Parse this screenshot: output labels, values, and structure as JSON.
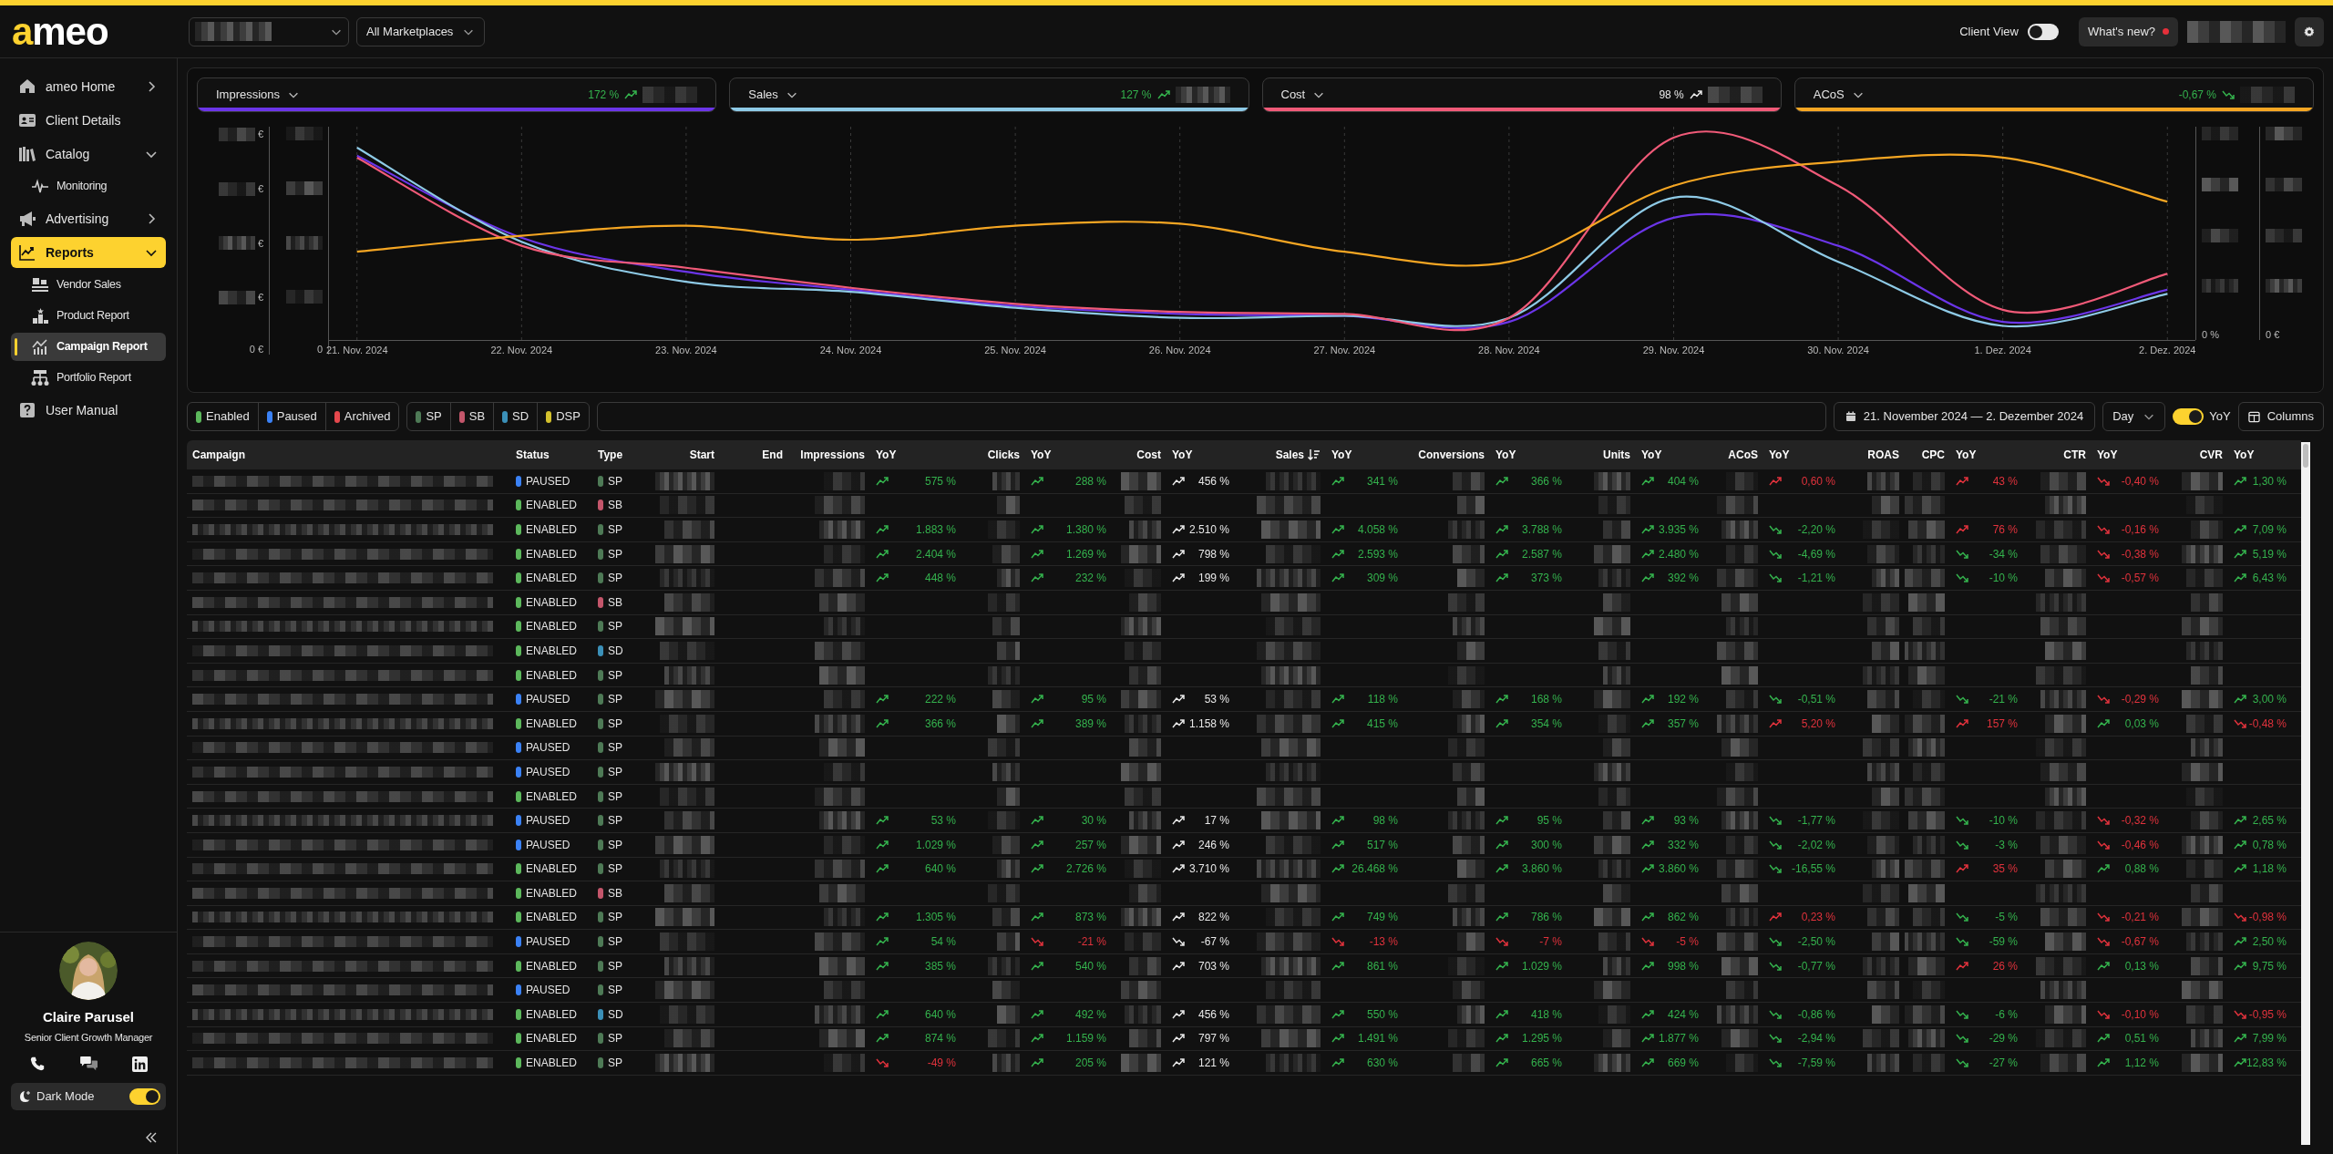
{
  "top_bar": {
    "logo": {
      "accent": "a",
      "rest": "meo"
    },
    "marketplace": "All Marketplaces",
    "client_view": {
      "label": "Client View",
      "on": false
    },
    "whats_new": {
      "label": "What's new?",
      "unread": true
    }
  },
  "sidebar": {
    "items": [
      {
        "label": "ameo Home",
        "expanded": false,
        "selected": false
      },
      {
        "label": "Client Details",
        "selected": false
      },
      {
        "label": "Catalog",
        "expanded": true,
        "selected": false,
        "children": [
          {
            "label": "Monitoring",
            "selected": false
          }
        ]
      },
      {
        "label": "Advertising",
        "expanded": false,
        "selected": false
      },
      {
        "label": "Reports",
        "expanded": true,
        "selected": true,
        "children": [
          {
            "label": "Vendor Sales",
            "selected": false
          },
          {
            "label": "Product Report",
            "selected": false
          },
          {
            "label": "Campaign Report",
            "selected": true
          },
          {
            "label": "Portfolio Report",
            "selected": false
          }
        ]
      },
      {
        "label": "User Manual",
        "selected": false
      }
    ],
    "profile": {
      "name": "Claire Parusel",
      "role": "Senior Client Growth Manager"
    },
    "dark_mode": {
      "label": "Dark Mode",
      "on": true
    }
  },
  "metrics": [
    {
      "label": "Impressions",
      "change": {
        "text": "172 %",
        "rising": true,
        "color": "#34b24d"
      },
      "color": "#6b35e8"
    },
    {
      "label": "Sales",
      "change": {
        "text": "127 %",
        "rising": true,
        "color": "#34b24d"
      },
      "color": "#8ecae6"
    },
    {
      "label": "Cost",
      "change": {
        "text": "98 %",
        "rising": true,
        "color": "#e8e8e8"
      },
      "color": "#f05a78"
    },
    {
      "label": "ACoS",
      "change": {
        "text": "-0,67 %",
        "rising": false,
        "color": "#34b24d"
      },
      "color": "#f5a623"
    }
  ],
  "chart": {
    "left_axis": {
      "tick_units": [
        "€",
        "€",
        "€",
        "€"
      ],
      "zero": "0 €"
    },
    "left_axis_2": {
      "zero": "0"
    },
    "right_axis": {
      "zero": "0 %"
    },
    "right_axis_2": {
      "zero": "0 €"
    },
    "x_labels": [
      "21. Nov. 2024",
      "22. Nov. 2024",
      "23. Nov. 2024",
      "24. Nov. 2024",
      "25. Nov. 2024",
      "26. Nov. 2024",
      "27. Nov. 2024",
      "28. Nov. 2024",
      "29. Nov. 2024",
      "30. Nov. 2024",
      "1. Dez. 2024",
      "2. Dez. 2024"
    ]
  },
  "filters": {
    "status": [
      {
        "label": "Enabled",
        "color": "#5cb85c"
      },
      {
        "label": "Paused",
        "color": "#3b82f6"
      },
      {
        "label": "Archived",
        "color": "#e5484d"
      }
    ],
    "types": [
      {
        "label": "SP",
        "color": "#4e7a56"
      },
      {
        "label": "SB",
        "color": "#c4566b"
      },
      {
        "label": "SD",
        "color": "#3b90b8"
      },
      {
        "label": "DSP",
        "color": "#d3c12d"
      }
    ],
    "date_range": "21. November 2024 — 2. Dezember 2024",
    "interval": "Day",
    "yoy": {
      "label": "YoY",
      "on": true
    },
    "columns_button": "Columns"
  },
  "table": {
    "columns": [
      {
        "label": "Campaign",
        "kind": "masked",
        "sorted": false
      },
      {
        "label": "Status",
        "kind": "status",
        "sorted": false
      },
      {
        "label": "Type",
        "kind": "type",
        "sorted": false
      },
      {
        "label": "Start",
        "kind": "masked",
        "sorted": false
      },
      {
        "label": "End",
        "kind": "empty",
        "sorted": false
      },
      {
        "label": "Impressions",
        "kind": "masked",
        "sorted": false
      },
      {
        "label": "YoY",
        "kind": "yoy",
        "sorted": false
      },
      {
        "label": "Clicks",
        "kind": "masked",
        "sorted": false
      },
      {
        "label": "YoY",
        "kind": "yoy",
        "sorted": false
      },
      {
        "label": "Cost",
        "kind": "masked",
        "sorted": false
      },
      {
        "label": "YoY",
        "kind": "yoy",
        "sorted": false
      },
      {
        "label": "Sales",
        "kind": "masked",
        "sorted": true
      },
      {
        "label": "YoY",
        "kind": "yoy",
        "sorted": false
      },
      {
        "label": "Conversions",
        "kind": "masked",
        "sorted": false
      },
      {
        "label": "YoY",
        "kind": "yoy",
        "sorted": false
      },
      {
        "label": "Units",
        "kind": "masked",
        "sorted": false
      },
      {
        "label": "YoY",
        "kind": "yoy",
        "sorted": false
      },
      {
        "label": "ACoS",
        "kind": "masked",
        "sorted": false
      },
      {
        "label": "YoY",
        "kind": "yoy",
        "sorted": false
      },
      {
        "label": "ROAS",
        "kind": "masked",
        "sorted": false
      },
      {
        "label": "CPC",
        "kind": "masked",
        "sorted": false
      },
      {
        "label": "YoY",
        "kind": "yoy",
        "sorted": false
      },
      {
        "label": "CTR",
        "kind": "masked",
        "sorted": false
      },
      {
        "label": "YoY",
        "kind": "yoy",
        "sorted": false
      },
      {
        "label": "CVR",
        "kind": "masked",
        "sorted": false
      },
      {
        "label": "YoY",
        "kind": "yoy",
        "sorted": false
      }
    ],
    "rows": [
      {
        "status": {
          "label": "PAUSED",
          "color": "#3b82f6"
        },
        "type": {
          "label": "SP",
          "color": "#4e7a56"
        },
        "yoy": [
          {
            "text": "575 %",
            "rising": true,
            "color": "#34b24d"
          },
          {
            "text": "288 %",
            "rising": true,
            "color": "#34b24d"
          },
          {
            "text": "456 %",
            "rising": true,
            "color": "#e8e8e8"
          },
          {
            "text": "341 %",
            "rising": true,
            "color": "#34b24d"
          },
          {
            "text": "366 %",
            "rising": true,
            "color": "#34b24d"
          },
          {
            "text": "404 %",
            "rising": true,
            "color": "#34b24d"
          },
          {
            "text": "0,60 %",
            "rising": true,
            "color": "#e0323c"
          },
          {
            "text": "43 %",
            "rising": true,
            "color": "#e0323c"
          },
          {
            "text": "-0,40 %",
            "rising": false,
            "color": "#e0323c"
          },
          {
            "text": "1,30 %",
            "rising": true,
            "color": "#34b24d"
          }
        ]
      },
      {
        "status": {
          "label": "ENABLED",
          "color": "#5cb85c"
        },
        "type": {
          "label": "SB",
          "color": "#c4566b"
        }
      },
      {
        "status": {
          "label": "ENABLED",
          "color": "#5cb85c"
        },
        "type": {
          "label": "SP",
          "color": "#4e7a56"
        },
        "yoy": [
          {
            "text": "1.883 %",
            "rising": true,
            "color": "#34b24d"
          },
          {
            "text": "1.380 %",
            "rising": true,
            "color": "#34b24d"
          },
          {
            "text": "2.510 %",
            "rising": true,
            "color": "#e8e8e8"
          },
          {
            "text": "4.058 %",
            "rising": true,
            "color": "#34b24d"
          },
          {
            "text": "3.788 %",
            "rising": true,
            "color": "#34b24d"
          },
          {
            "text": "3.935 %",
            "rising": true,
            "color": "#34b24d"
          },
          {
            "text": "-2,20 %",
            "rising": false,
            "color": "#34b24d"
          },
          {
            "text": "76 %",
            "rising": true,
            "color": "#e0323c"
          },
          {
            "text": "-0,16 %",
            "rising": false,
            "color": "#e0323c"
          },
          {
            "text": "7,09 %",
            "rising": true,
            "color": "#34b24d"
          }
        ]
      },
      {
        "status": {
          "label": "ENABLED",
          "color": "#5cb85c"
        },
        "type": {
          "label": "SP",
          "color": "#4e7a56"
        },
        "yoy": [
          {
            "text": "2.404 %",
            "rising": true,
            "color": "#34b24d"
          },
          {
            "text": "1.269 %",
            "rising": true,
            "color": "#34b24d"
          },
          {
            "text": "798 %",
            "rising": true,
            "color": "#e8e8e8"
          },
          {
            "text": "2.593 %",
            "rising": true,
            "color": "#34b24d"
          },
          {
            "text": "2.587 %",
            "rising": true,
            "color": "#34b24d"
          },
          {
            "text": "2.480 %",
            "rising": true,
            "color": "#34b24d"
          },
          {
            "text": "-4,69 %",
            "rising": false,
            "color": "#34b24d"
          },
          {
            "text": "-34 %",
            "rising": false,
            "color": "#34b24d"
          },
          {
            "text": "-0,38 %",
            "rising": false,
            "color": "#e0323c"
          },
          {
            "text": "5,19 %",
            "rising": true,
            "color": "#34b24d"
          }
        ]
      },
      {
        "status": {
          "label": "ENABLED",
          "color": "#5cb85c"
        },
        "type": {
          "label": "SP",
          "color": "#4e7a56"
        },
        "yoy": [
          {
            "text": "448 %",
            "rising": true,
            "color": "#34b24d"
          },
          {
            "text": "232 %",
            "rising": true,
            "color": "#34b24d"
          },
          {
            "text": "199 %",
            "rising": true,
            "color": "#e8e8e8"
          },
          {
            "text": "309 %",
            "rising": true,
            "color": "#34b24d"
          },
          {
            "text": "373 %",
            "rising": true,
            "color": "#34b24d"
          },
          {
            "text": "392 %",
            "rising": true,
            "color": "#34b24d"
          },
          {
            "text": "-1,21 %",
            "rising": false,
            "color": "#34b24d"
          },
          {
            "text": "-10 %",
            "rising": false,
            "color": "#34b24d"
          },
          {
            "text": "-0,57 %",
            "rising": false,
            "color": "#e0323c"
          },
          {
            "text": "6,43 %",
            "rising": true,
            "color": "#34b24d"
          }
        ]
      },
      {
        "status": {
          "label": "ENABLED",
          "color": "#5cb85c"
        },
        "type": {
          "label": "SB",
          "color": "#c4566b"
        }
      },
      {
        "status": {
          "label": "ENABLED",
          "color": "#5cb85c"
        },
        "type": {
          "label": "SP",
          "color": "#4e7a56"
        }
      },
      {
        "status": {
          "label": "ENABLED",
          "color": "#5cb85c"
        },
        "type": {
          "label": "SD",
          "color": "#3b90b8"
        }
      },
      {
        "status": {
          "label": "ENABLED",
          "color": "#5cb85c"
        },
        "type": {
          "label": "SP",
          "color": "#4e7a56"
        }
      },
      {
        "status": {
          "label": "PAUSED",
          "color": "#3b82f6"
        },
        "type": {
          "label": "SP",
          "color": "#4e7a56"
        },
        "yoy": [
          {
            "text": "222 %",
            "rising": true,
            "color": "#34b24d"
          },
          {
            "text": "95 %",
            "rising": true,
            "color": "#34b24d"
          },
          {
            "text": "53 %",
            "rising": true,
            "color": "#e8e8e8"
          },
          {
            "text": "118 %",
            "rising": true,
            "color": "#34b24d"
          },
          {
            "text": "168 %",
            "rising": true,
            "color": "#34b24d"
          },
          {
            "text": "192 %",
            "rising": true,
            "color": "#34b24d"
          },
          {
            "text": "-0,51 %",
            "rising": false,
            "color": "#34b24d"
          },
          {
            "text": "-21 %",
            "rising": false,
            "color": "#34b24d"
          },
          {
            "text": "-0,29 %",
            "rising": false,
            "color": "#e0323c"
          },
          {
            "text": "3,00 %",
            "rising": true,
            "color": "#34b24d"
          }
        ]
      },
      {
        "status": {
          "label": "ENABLED",
          "color": "#5cb85c"
        },
        "type": {
          "label": "SP",
          "color": "#4e7a56"
        },
        "yoy": [
          {
            "text": "366 %",
            "rising": true,
            "color": "#34b24d"
          },
          {
            "text": "389 %",
            "rising": true,
            "color": "#34b24d"
          },
          {
            "text": "1.158 %",
            "rising": true,
            "color": "#e8e8e8"
          },
          {
            "text": "415 %",
            "rising": true,
            "color": "#34b24d"
          },
          {
            "text": "354 %",
            "rising": true,
            "color": "#34b24d"
          },
          {
            "text": "357 %",
            "rising": true,
            "color": "#34b24d"
          },
          {
            "text": "5,20 %",
            "rising": true,
            "color": "#e0323c"
          },
          {
            "text": "157 %",
            "rising": true,
            "color": "#e0323c"
          },
          {
            "text": "0,03 %",
            "rising": true,
            "color": "#34b24d"
          },
          {
            "text": "-0,48 %",
            "rising": false,
            "color": "#e0323c"
          }
        ]
      },
      {
        "status": {
          "label": "PAUSED",
          "color": "#3b82f6"
        },
        "type": {
          "label": "SP",
          "color": "#4e7a56"
        }
      },
      {
        "status": {
          "label": "PAUSED",
          "color": "#3b82f6"
        },
        "type": {
          "label": "SP",
          "color": "#4e7a56"
        }
      },
      {
        "status": {
          "label": "ENABLED",
          "color": "#5cb85c"
        },
        "type": {
          "label": "SP",
          "color": "#4e7a56"
        }
      },
      {
        "status": {
          "label": "PAUSED",
          "color": "#3b82f6"
        },
        "type": {
          "label": "SP",
          "color": "#4e7a56"
        },
        "yoy": [
          {
            "text": "53 %",
            "rising": true,
            "color": "#34b24d"
          },
          {
            "text": "30 %",
            "rising": true,
            "color": "#34b24d"
          },
          {
            "text": "17 %",
            "rising": true,
            "color": "#e8e8e8"
          },
          {
            "text": "98 %",
            "rising": true,
            "color": "#34b24d"
          },
          {
            "text": "95 %",
            "rising": true,
            "color": "#34b24d"
          },
          {
            "text": "93 %",
            "rising": true,
            "color": "#34b24d"
          },
          {
            "text": "-1,77 %",
            "rising": false,
            "color": "#34b24d"
          },
          {
            "text": "-10 %",
            "rising": false,
            "color": "#34b24d"
          },
          {
            "text": "-0,32 %",
            "rising": false,
            "color": "#e0323c"
          },
          {
            "text": "2,65 %",
            "rising": true,
            "color": "#34b24d"
          }
        ]
      },
      {
        "status": {
          "label": "PAUSED",
          "color": "#3b82f6"
        },
        "type": {
          "label": "SP",
          "color": "#4e7a56"
        },
        "yoy": [
          {
            "text": "1.029 %",
            "rising": true,
            "color": "#34b24d"
          },
          {
            "text": "257 %",
            "rising": true,
            "color": "#34b24d"
          },
          {
            "text": "246 %",
            "rising": true,
            "color": "#e8e8e8"
          },
          {
            "text": "517 %",
            "rising": true,
            "color": "#34b24d"
          },
          {
            "text": "300 %",
            "rising": true,
            "color": "#34b24d"
          },
          {
            "text": "332 %",
            "rising": true,
            "color": "#34b24d"
          },
          {
            "text": "-2,02 %",
            "rising": false,
            "color": "#34b24d"
          },
          {
            "text": "-3 %",
            "rising": false,
            "color": "#34b24d"
          },
          {
            "text": "-0,46 %",
            "rising": false,
            "color": "#e0323c"
          },
          {
            "text": "0,78 %",
            "rising": true,
            "color": "#34b24d"
          }
        ]
      },
      {
        "status": {
          "label": "ENABLED",
          "color": "#5cb85c"
        },
        "type": {
          "label": "SP",
          "color": "#4e7a56"
        },
        "yoy": [
          {
            "text": "640 %",
            "rising": true,
            "color": "#34b24d"
          },
          {
            "text": "2.726 %",
            "rising": true,
            "color": "#34b24d"
          },
          {
            "text": "3.710 %",
            "rising": true,
            "color": "#e8e8e8"
          },
          {
            "text": "26.468 %",
            "rising": true,
            "color": "#34b24d"
          },
          {
            "text": "3.860 %",
            "rising": true,
            "color": "#34b24d"
          },
          {
            "text": "3.860 %",
            "rising": true,
            "color": "#34b24d"
          },
          {
            "text": "-16,55 %",
            "rising": false,
            "color": "#34b24d"
          },
          {
            "text": "35 %",
            "rising": true,
            "color": "#e0323c"
          },
          {
            "text": "0,88 %",
            "rising": true,
            "color": "#34b24d"
          },
          {
            "text": "1,18 %",
            "rising": true,
            "color": "#34b24d"
          }
        ]
      },
      {
        "status": {
          "label": "ENABLED",
          "color": "#5cb85c"
        },
        "type": {
          "label": "SB",
          "color": "#c4566b"
        }
      },
      {
        "status": {
          "label": "ENABLED",
          "color": "#5cb85c"
        },
        "type": {
          "label": "SP",
          "color": "#4e7a56"
        },
        "yoy": [
          {
            "text": "1.305 %",
            "rising": true,
            "color": "#34b24d"
          },
          {
            "text": "873 %",
            "rising": true,
            "color": "#34b24d"
          },
          {
            "text": "822 %",
            "rising": true,
            "color": "#e8e8e8"
          },
          {
            "text": "749 %",
            "rising": true,
            "color": "#34b24d"
          },
          {
            "text": "786 %",
            "rising": true,
            "color": "#34b24d"
          },
          {
            "text": "862 %",
            "rising": true,
            "color": "#34b24d"
          },
          {
            "text": "0,23 %",
            "rising": true,
            "color": "#e0323c"
          },
          {
            "text": "-5 %",
            "rising": false,
            "color": "#34b24d"
          },
          {
            "text": "-0,21 %",
            "rising": false,
            "color": "#e0323c"
          },
          {
            "text": "-0,98 %",
            "rising": false,
            "color": "#e0323c"
          }
        ]
      },
      {
        "status": {
          "label": "PAUSED",
          "color": "#3b82f6"
        },
        "type": {
          "label": "SP",
          "color": "#4e7a56"
        },
        "yoy": [
          {
            "text": "54 %",
            "rising": true,
            "color": "#34b24d"
          },
          {
            "text": "-21 %",
            "rising": false,
            "color": "#e0323c"
          },
          {
            "text": "-67 %",
            "rising": false,
            "color": "#e8e8e8"
          },
          {
            "text": "-13 %",
            "rising": false,
            "color": "#e0323c"
          },
          {
            "text": "-7 %",
            "rising": false,
            "color": "#e0323c"
          },
          {
            "text": "-5 %",
            "rising": false,
            "color": "#e0323c"
          },
          {
            "text": "-2,50 %",
            "rising": false,
            "color": "#34b24d"
          },
          {
            "text": "-59 %",
            "rising": false,
            "color": "#34b24d"
          },
          {
            "text": "-0,67 %",
            "rising": false,
            "color": "#e0323c"
          },
          {
            "text": "2,50 %",
            "rising": true,
            "color": "#34b24d"
          }
        ]
      },
      {
        "status": {
          "label": "ENABLED",
          "color": "#5cb85c"
        },
        "type": {
          "label": "SP",
          "color": "#4e7a56"
        },
        "yoy": [
          {
            "text": "385 %",
            "rising": true,
            "color": "#34b24d"
          },
          {
            "text": "540 %",
            "rising": true,
            "color": "#34b24d"
          },
          {
            "text": "703 %",
            "rising": true,
            "color": "#e8e8e8"
          },
          {
            "text": "861 %",
            "rising": true,
            "color": "#34b24d"
          },
          {
            "text": "1.029 %",
            "rising": true,
            "color": "#34b24d"
          },
          {
            "text": "998 %",
            "rising": true,
            "color": "#34b24d"
          },
          {
            "text": "-0,77 %",
            "rising": false,
            "color": "#34b24d"
          },
          {
            "text": "26 %",
            "rising": true,
            "color": "#e0323c"
          },
          {
            "text": "0,13 %",
            "rising": true,
            "color": "#34b24d"
          },
          {
            "text": "9,75 %",
            "rising": true,
            "color": "#34b24d"
          }
        ]
      },
      {
        "status": {
          "label": "PAUSED",
          "color": "#3b82f6"
        },
        "type": {
          "label": "SP",
          "color": "#4e7a56"
        }
      },
      {
        "status": {
          "label": "ENABLED",
          "color": "#5cb85c"
        },
        "type": {
          "label": "SD",
          "color": "#3b90b8"
        },
        "yoy": [
          {
            "text": "640 %",
            "rising": true,
            "color": "#34b24d"
          },
          {
            "text": "492 %",
            "rising": true,
            "color": "#34b24d"
          },
          {
            "text": "456 %",
            "rising": true,
            "color": "#e8e8e8"
          },
          {
            "text": "550 %",
            "rising": true,
            "color": "#34b24d"
          },
          {
            "text": "418 %",
            "rising": true,
            "color": "#34b24d"
          },
          {
            "text": "424 %",
            "rising": true,
            "color": "#34b24d"
          },
          {
            "text": "-0,86 %",
            "rising": false,
            "color": "#34b24d"
          },
          {
            "text": "-6 %",
            "rising": false,
            "color": "#34b24d"
          },
          {
            "text": "-0,10 %",
            "rising": false,
            "color": "#e0323c"
          },
          {
            "text": "-0,95 %",
            "rising": false,
            "color": "#e0323c"
          }
        ]
      },
      {
        "status": {
          "label": "ENABLED",
          "color": "#5cb85c"
        },
        "type": {
          "label": "SP",
          "color": "#4e7a56"
        },
        "yoy": [
          {
            "text": "874 %",
            "rising": true,
            "color": "#34b24d"
          },
          {
            "text": "1.159 %",
            "rising": true,
            "color": "#34b24d"
          },
          {
            "text": "797 %",
            "rising": true,
            "color": "#e8e8e8"
          },
          {
            "text": "1.491 %",
            "rising": true,
            "color": "#34b24d"
          },
          {
            "text": "1.295 %",
            "rising": true,
            "color": "#34b24d"
          },
          {
            "text": "1.877 %",
            "rising": true,
            "color": "#34b24d"
          },
          {
            "text": "-2,94 %",
            "rising": false,
            "color": "#34b24d"
          },
          {
            "text": "-29 %",
            "rising": false,
            "color": "#34b24d"
          },
          {
            "text": "0,51 %",
            "rising": true,
            "color": "#34b24d"
          },
          {
            "text": "7,99 %",
            "rising": true,
            "color": "#34b24d"
          }
        ]
      },
      {
        "status": {
          "label": "ENABLED",
          "color": "#5cb85c"
        },
        "type": {
          "label": "SP",
          "color": "#4e7a56"
        },
        "yoy": [
          {
            "text": "-49 %",
            "rising": false,
            "color": "#e0323c"
          },
          {
            "text": "205 %",
            "rising": true,
            "color": "#34b24d"
          },
          {
            "text": "121 %",
            "rising": true,
            "color": "#e8e8e8"
          },
          {
            "text": "630 %",
            "rising": true,
            "color": "#34b24d"
          },
          {
            "text": "665 %",
            "rising": true,
            "color": "#34b24d"
          },
          {
            "text": "669 %",
            "rising": true,
            "color": "#34b24d"
          },
          {
            "text": "-7,59 %",
            "rising": false,
            "color": "#34b24d"
          },
          {
            "text": "-27 %",
            "rising": false,
            "color": "#34b24d"
          },
          {
            "text": "1,12 %",
            "rising": true,
            "color": "#34b24d"
          },
          {
            "text": "12,83 %",
            "rising": true,
            "color": "#34b24d"
          }
        ]
      }
    ]
  }
}
